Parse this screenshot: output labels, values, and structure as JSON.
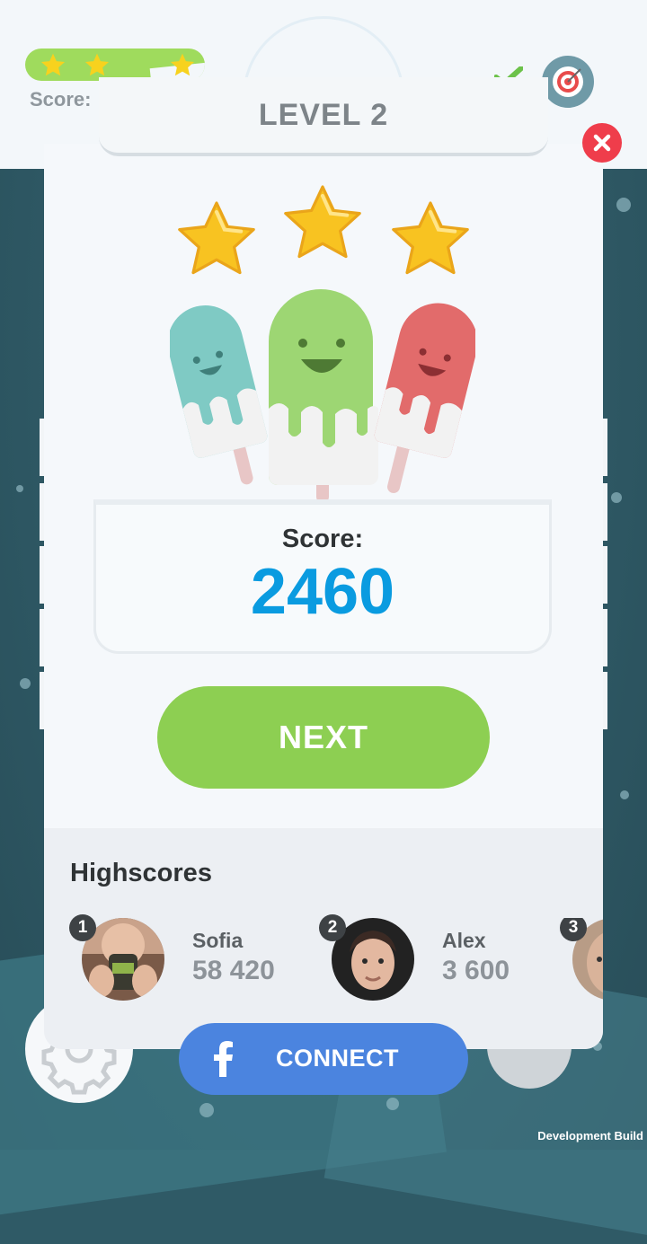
{
  "hud": {
    "stars_earned": 3,
    "score_label": "Score:"
  },
  "level": {
    "title": "LEVEL 2",
    "stars": 3
  },
  "result": {
    "score_label": "Score:",
    "score_value": "2460",
    "next_label": "NEXT"
  },
  "highscores": {
    "title": "Highscores",
    "entries": [
      {
        "rank": "1",
        "name": "Sofia",
        "score": "58 420"
      },
      {
        "rank": "2",
        "name": "Alex",
        "score": "3 600"
      },
      {
        "rank": "3",
        "name": "",
        "score": ""
      }
    ]
  },
  "bottom": {
    "connect_label": "CONNECT"
  },
  "footer": {
    "build_label": "Development Build"
  },
  "colors": {
    "accent_green": "#8dcf52",
    "score_blue": "#0a9be0",
    "facebook_blue": "#4b84df",
    "close_red": "#ef3d4b"
  }
}
